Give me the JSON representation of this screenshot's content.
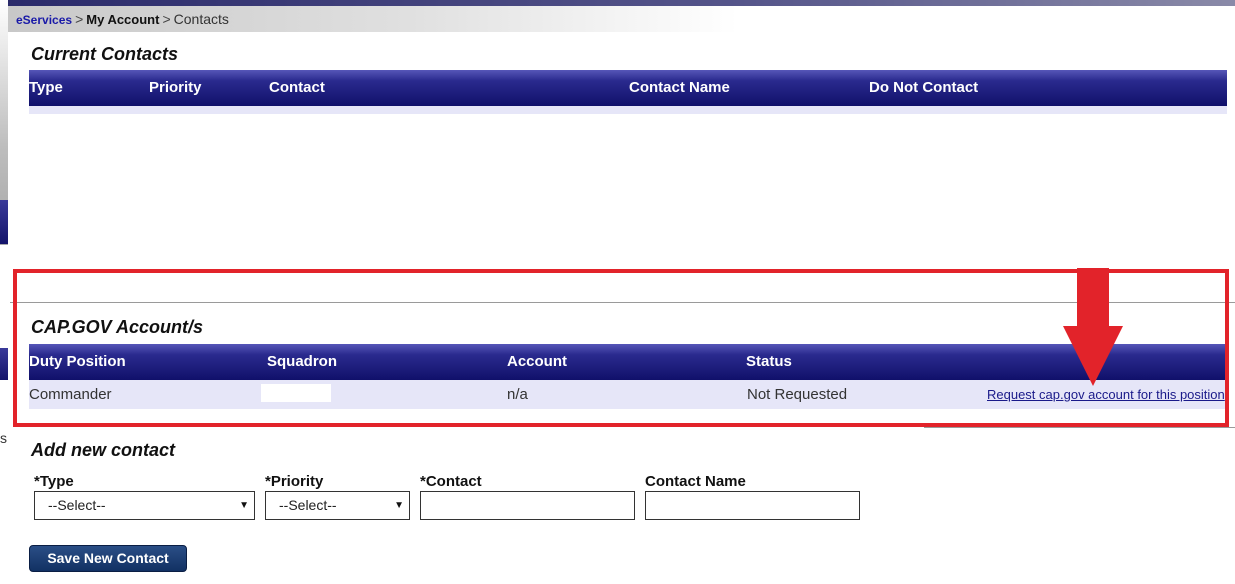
{
  "breadcrumb": {
    "root": "eServices",
    "separator": ">",
    "parent": "My Account",
    "current": "Contacts"
  },
  "current_contacts": {
    "title": "Current Contacts",
    "columns": [
      "Type",
      "Priority",
      "Contact",
      "Contact Name",
      "Do Not Contact"
    ]
  },
  "cap_gov": {
    "title": "CAP.GOV Account/s",
    "columns": [
      "Duty Position",
      "Squadron",
      "Account",
      "Status"
    ],
    "rows": [
      {
        "duty_position": "Commander",
        "squadron": "",
        "account": "n/a",
        "status": "Not Requested",
        "action": "Request cap.gov account for this position"
      }
    ]
  },
  "add_contact": {
    "title": "Add new contact",
    "type_label": "*Type",
    "type_value": "--Select--",
    "priority_label": "*Priority",
    "priority_value": "--Select--",
    "contact_label": "*Contact",
    "contact_value": "",
    "contact_name_label": "Contact Name",
    "contact_name_value": "",
    "save_button": "Save New Contact"
  },
  "left_edge_fragment": "s",
  "colors": {
    "header_navy": "#10106a",
    "highlight_red": "#e2232a",
    "link_blue": "#1a1aa8",
    "row_shade": "#e6e6f8"
  },
  "icons": {
    "dropdown": "caret-down",
    "annotation": "arrow-down"
  }
}
